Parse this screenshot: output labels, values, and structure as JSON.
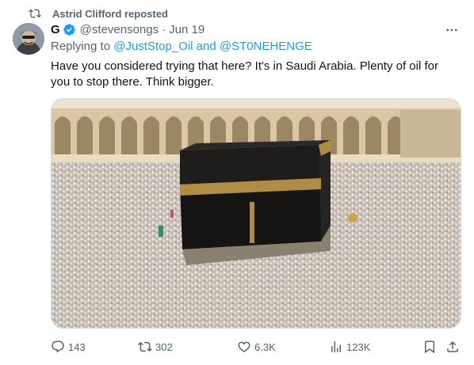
{
  "repost": {
    "text": "Astrid Clifford reposted",
    "icon": "repost-icon"
  },
  "author": {
    "display_name": "G",
    "handle": "@stevensongs",
    "separator": "·",
    "date": "Jun 19",
    "verified": true
  },
  "replying": {
    "prefix": "Replying to ",
    "first": "@JustStop_Oil",
    "and": " and ",
    "second": "@ST0NEHENGE"
  },
  "tweet": {
    "text": "Have you considered trying that here? It's in Saudi Arabia. Plenty of oil for you to stop there. Think bigger."
  },
  "actions": {
    "reply": {
      "icon": "reply-icon",
      "count": "143"
    },
    "repost": {
      "icon": "repost-icon",
      "count": "302"
    },
    "like": {
      "icon": "heart-icon",
      "count": "6.3K"
    },
    "views": {
      "icon": "views-icon",
      "count": "123K"
    },
    "bookmark": {
      "icon": "bookmark-icon"
    },
    "share": {
      "icon": "share-icon"
    }
  },
  "colors": {
    "accent": "#1d9bf0",
    "muted": "#536471",
    "text": "#0f1419",
    "border": "#cfd9de"
  }
}
